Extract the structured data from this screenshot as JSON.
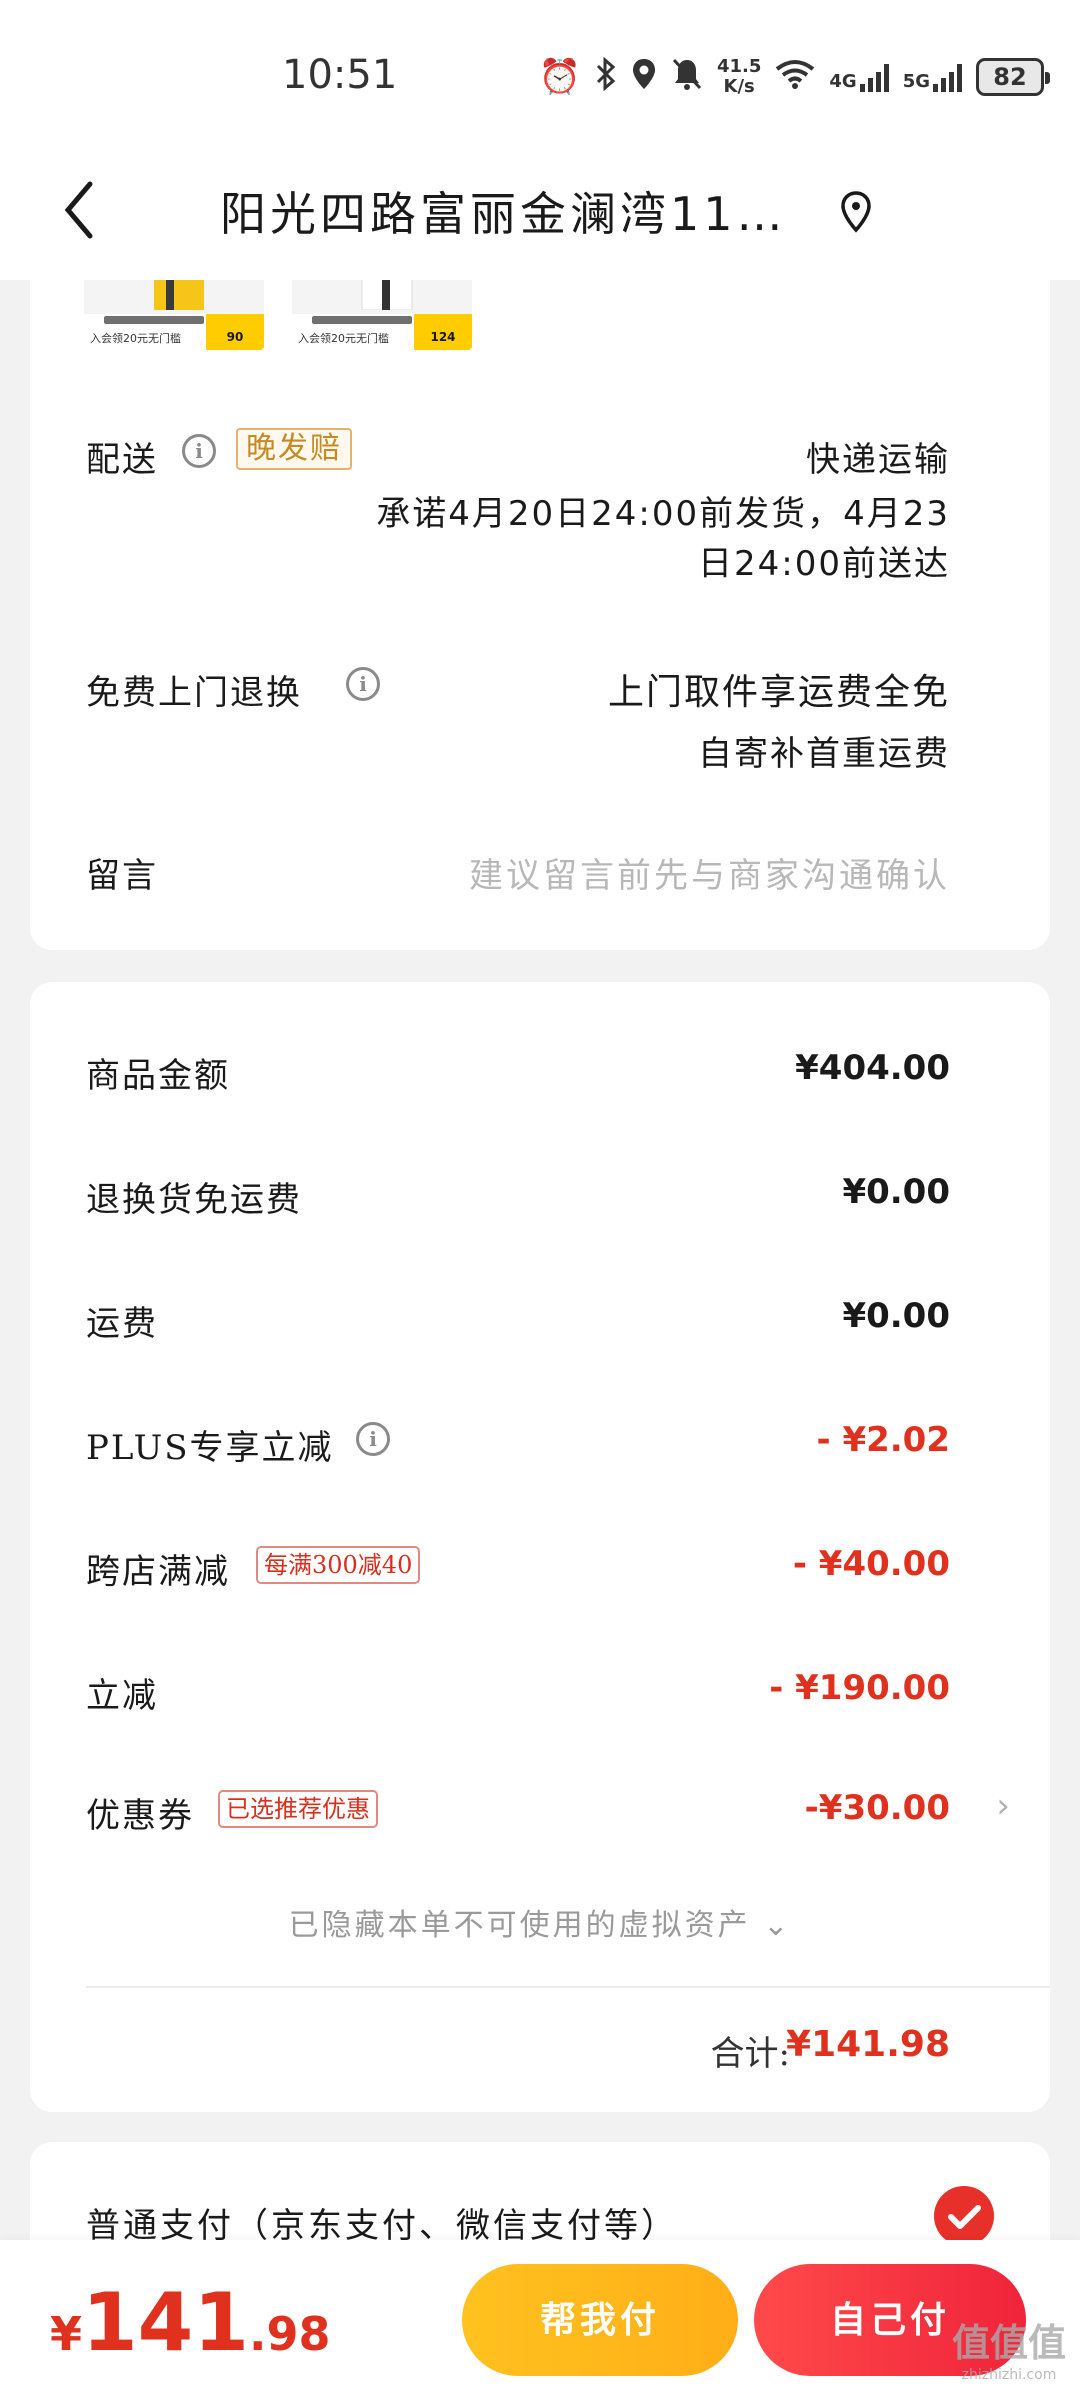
{
  "status": {
    "time": "10:51",
    "speed_top": "41.5",
    "speed_bottom": "K/s",
    "net1": "4G",
    "net2": "5G",
    "battery": "82"
  },
  "nav": {
    "title": "阳光四路富丽金澜湾11…"
  },
  "delivery": {
    "label": "配送",
    "tag": "晚发赔",
    "method": "快递运输",
    "promise_line1": "承诺4月20日24:00前发货，4月23",
    "promise_line2": "日24:00前送达"
  },
  "thumbs": [
    {
      "price": "90",
      "promo": "入会领20元无门槛"
    },
    {
      "price": "124",
      "promo": "入会领20元无门槛"
    }
  ],
  "returns": {
    "label": "免费上门退换",
    "line1": "上门取件享运费全免",
    "line2": "自寄补首重运费"
  },
  "message": {
    "label": "留言",
    "placeholder": "建议留言前先与商家沟通确认"
  },
  "prices": {
    "goods_label": "商品金额",
    "goods_value": "¥404.00",
    "return_free_label": "退换货免运费",
    "return_free_value": "¥0.00",
    "shipping_label": "运费",
    "shipping_value": "¥0.00",
    "plus_label": "PLUS专享立减",
    "plus_value": "- ¥2.02",
    "cross_label": "跨店满减",
    "cross_tag": "每满300减40",
    "cross_value": "- ¥40.00",
    "instant_label": "立减",
    "instant_value": "- ¥190.00",
    "coupon_label": "优惠券",
    "coupon_tag": "已选推荐优惠",
    "coupon_value": "-¥30.00",
    "hidden_note": "已隐藏本单不可使用的虚拟资产",
    "total_label": "合计:",
    "total_value": "¥141.98"
  },
  "payment": {
    "method_label": "普通支付（京东支付、微信支付等）"
  },
  "bottom": {
    "currency": "¥",
    "amount_int": "141",
    "amount_dec": ".98",
    "help_pay": "帮我付",
    "self_pay": "自己付",
    "watermark": "值值值",
    "watermark_sub": "zhizhizhi.com"
  },
  "colors": {
    "accent_red": "#e0301e",
    "help_yellow": "#ffb81c",
    "self_red": "#f0233a"
  }
}
